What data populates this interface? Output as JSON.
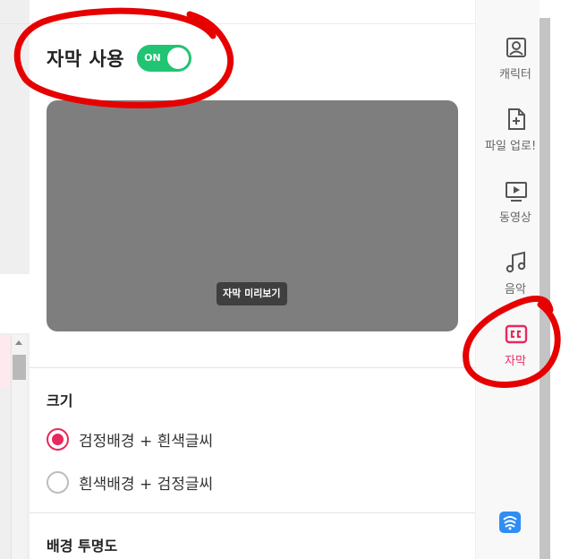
{
  "subtitle_panel": {
    "title": "자막 사용",
    "toggle_label": "ON",
    "preview_caption": "자막 미리보기",
    "size_section": {
      "label": "크기",
      "options": [
        {
          "label": "검정배경 + 흰색글씨",
          "selected": true
        },
        {
          "label": "흰색배경 + 검정글씨",
          "selected": false
        }
      ]
    },
    "opacity_section": {
      "label": "배경 투명도"
    }
  },
  "sidebar": {
    "items": [
      {
        "label": "캐릭터",
        "icon": "portrait-icon",
        "active": false
      },
      {
        "label": "파일 업로!",
        "icon": "file-add-icon",
        "active": false
      },
      {
        "label": "동영상",
        "icon": "video-play-icon",
        "active": false
      },
      {
        "label": "음악",
        "icon": "music-note-icon",
        "active": false
      },
      {
        "label": "자막",
        "icon": "cc-icon",
        "active": true
      }
    ]
  },
  "colors": {
    "toggle_on": "#20c472",
    "accent": "#e8295e",
    "annotation": "#e60000"
  }
}
